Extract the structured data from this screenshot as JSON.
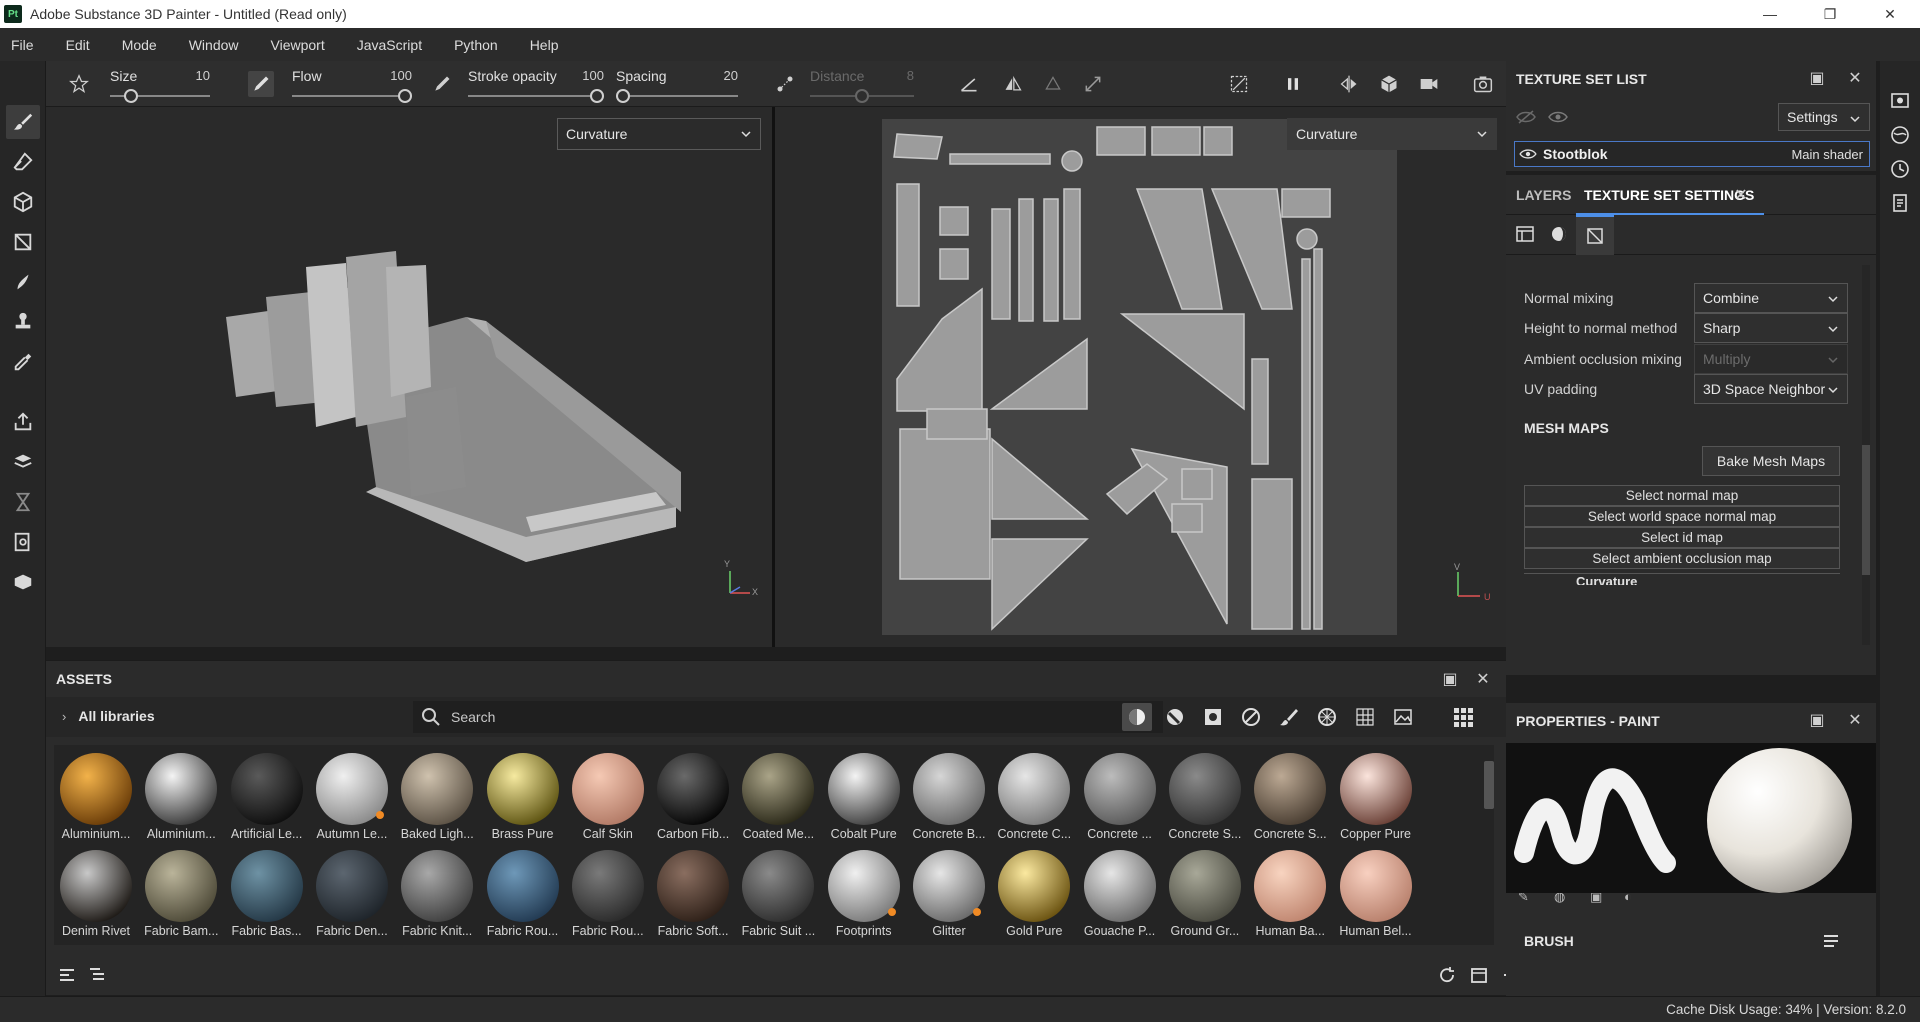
{
  "window": {
    "app_badge": "Pt",
    "title": "Adobe Substance 3D Painter - Untitled (Read only)",
    "minimize": "—",
    "restore": "❐",
    "close": "✕"
  },
  "menu": [
    "File",
    "Edit",
    "Mode",
    "Window",
    "Viewport",
    "JavaScript",
    "Python",
    "Help"
  ],
  "toolbar": {
    "size": {
      "label": "Size",
      "value": "10",
      "fraction": 0.16
    },
    "flow": {
      "label": "Flow",
      "value": "100",
      "fraction": 1.0
    },
    "stroke_opacity": {
      "label": "Stroke opacity",
      "value": "100",
      "fraction": 1.0
    },
    "spacing": {
      "label": "Spacing",
      "value": "20",
      "fraction": 0.0
    },
    "distance": {
      "label": "Distance",
      "value": "8",
      "fraction": 0.5
    }
  },
  "viewport": {
    "left_mode": "Curvature",
    "right_mode": "Curvature",
    "axis_y": "Y",
    "axis_x": "X",
    "axis_v": "V",
    "axis_u": "U"
  },
  "assets": {
    "title": "ASSETS",
    "library": "All libraries",
    "search_placeholder": "Search",
    "row1": [
      {
        "name": "Aluminium...",
        "c1": "#f2b24a",
        "c2": "#6a3c08",
        "badge": false
      },
      {
        "name": "Aluminium...",
        "c1": "#f4f4f4",
        "c2": "#3a3a3a",
        "badge": false
      },
      {
        "name": "Artificial Le...",
        "c1": "#5a5a5a",
        "c2": "#0e0e0e",
        "badge": false
      },
      {
        "name": "Autumn Le...",
        "c1": "#f0f0f0",
        "c2": "#8a8a8a",
        "badge": true
      },
      {
        "name": "Baked Ligh...",
        "c1": "#cfc2ae",
        "c2": "#5c5245",
        "badge": false
      },
      {
        "name": "Brass Pure",
        "c1": "#f6eaa0",
        "c2": "#5e5412",
        "badge": false
      },
      {
        "name": "Calf Skin",
        "c1": "#f5c9b4",
        "c2": "#b27a66",
        "badge": false
      },
      {
        "name": "Carbon Fib...",
        "c1": "#6a6a6a",
        "c2": "#050505",
        "badge": false
      },
      {
        "name": "Coated Me...",
        "c1": "#aaa488",
        "c2": "#2a2818",
        "badge": false
      },
      {
        "name": "Cobalt Pure",
        "c1": "#f4f4f4",
        "c2": "#404040",
        "badge": false
      },
      {
        "name": "Concrete B...",
        "c1": "#d6d6d6",
        "c2": "#6a6a6a",
        "badge": false
      },
      {
        "name": "Concrete C...",
        "c1": "#e6e6e6",
        "c2": "#7a7a7a",
        "badge": false
      },
      {
        "name": "Concrete ...",
        "c1": "#bcbcbc",
        "c2": "#5a5a5a",
        "badge": false
      },
      {
        "name": "Concrete S...",
        "c1": "#8a8a8a",
        "c2": "#333333",
        "badge": false
      },
      {
        "name": "Concrete S...",
        "c1": "#bca994",
        "c2": "#4a3e32",
        "badge": false
      },
      {
        "name": "Copper Pure",
        "c1": "#fbe4dc",
        "c2": "#6a4036",
        "badge": false
      }
    ],
    "row2": [
      {
        "name": "Denim Rivet",
        "c1": "#c8c8c8",
        "c2": "#1e1a16",
        "badge": false
      },
      {
        "name": "Fabric Bam...",
        "c1": "#bab49a",
        "c2": "#4e4a38",
        "badge": false
      },
      {
        "name": "Fabric Bas...",
        "c1": "#6e92a4",
        "c2": "#243846",
        "badge": false
      },
      {
        "name": "Fabric Den...",
        "c1": "#5c6670",
        "c2": "#1e242a",
        "badge": false
      },
      {
        "name": "Fabric Knit...",
        "c1": "#a8a8a8",
        "c2": "#404040",
        "badge": false
      },
      {
        "name": "Fabric Rou...",
        "c1": "#6e98b8",
        "c2": "#223a52",
        "badge": false
      },
      {
        "name": "Fabric Rou...",
        "c1": "#7a7a7a",
        "c2": "#2a2a2a",
        "badge": false
      },
      {
        "name": "Fabric Soft...",
        "c1": "#8a6e60",
        "c2": "#2e2018",
        "badge": false
      },
      {
        "name": "Fabric Suit ...",
        "c1": "#8a8a8a",
        "c2": "#2e2e2e",
        "badge": false
      },
      {
        "name": "Footprints",
        "c1": "#f0f0f0",
        "c2": "#7a7a7a",
        "badge": true
      },
      {
        "name": "Glitter",
        "c1": "#e6e6e6",
        "c2": "#6a6a6a",
        "badge": true
      },
      {
        "name": "Gold Pure",
        "c1": "#fbe9a0",
        "c2": "#6a5210",
        "badge": false
      },
      {
        "name": "Gouache P...",
        "c1": "#e6e6e6",
        "c2": "#6a6a6a",
        "badge": false
      },
      {
        "name": "Ground Gr...",
        "c1": "#a8a898",
        "c2": "#4a4a40",
        "badge": false
      },
      {
        "name": "Human Ba...",
        "c1": "#f8d4c0",
        "c2": "#c08670",
        "badge": false
      },
      {
        "name": "Human Bel...",
        "c1": "#f8d0c0",
        "c2": "#b8806c",
        "badge": false
      }
    ]
  },
  "texture_set_list": {
    "title": "TEXTURE SET LIST",
    "settings_label": "Settings",
    "item_name": "Stootblok",
    "item_shader": "Main shader"
  },
  "texture_set_settings": {
    "tab_layers": "LAYERS",
    "tab_settings": "TEXTURE SET SETTINGS",
    "fields": [
      {
        "label": "Normal mixing",
        "value": "Combine",
        "disabled": false
      },
      {
        "label": "Height to normal method",
        "value": "Sharp",
        "disabled": false
      },
      {
        "label": "Ambient occlusion mixing",
        "value": "Multiply",
        "disabled": true
      },
      {
        "label": "UV padding",
        "value": "3D Space Neighbor",
        "disabled": false
      }
    ],
    "mesh_maps_header": "MESH MAPS",
    "bake_button": "Bake Mesh Maps",
    "select_buttons": [
      "Select normal map",
      "Select world space normal map",
      "Select id map",
      "Select ambient occlusion map"
    ],
    "next_item": "Curvature"
  },
  "properties": {
    "title": "PROPERTIES - PAINT",
    "brush_header": "BRUSH"
  },
  "status": {
    "text": "Cache Disk Usage:   34% | Version: 8.2.0"
  }
}
